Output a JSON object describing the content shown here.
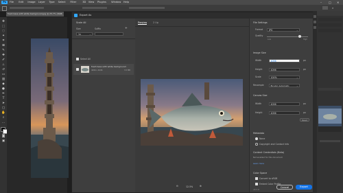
{
  "app": {
    "logo": "Ps"
  },
  "menu": [
    "File",
    "Edit",
    "Image",
    "Layer",
    "Type",
    "Select",
    "Filter",
    "3D",
    "View",
    "Plugins",
    "Window",
    "Help"
  ],
  "doc_tab": {
    "title": "fresh bass with white background.jpg @ 25.7% (RGB/8)"
  },
  "dialog": {
    "title": "Export As",
    "scale_all": {
      "header": "Scale All",
      "size_label": "Size",
      "suffix_label": "Suffix",
      "size_value": "1x",
      "suffix_value": "",
      "add_symbol": "+"
    },
    "select_all_label": "Select All",
    "layer_item": {
      "name": "fresh bass with white background",
      "size": "4096 x 4096",
      "filesize": "3.5 MB"
    },
    "preview_tabs": [
      "Preview",
      "2 Up"
    ],
    "zoom": "12.5%",
    "file_settings": {
      "header": "File Settings",
      "format_label": "Format",
      "format_value": "JPG",
      "quality_label": "Quality",
      "quality_low": "Low",
      "quality_high": "High",
      "quality": 0.8
    },
    "image_size": {
      "header": "Image Size",
      "width_label": "Width",
      "width_value": "4096",
      "height_label": "Height",
      "height_value": "4096",
      "scale_label": "Scale",
      "scale_value": "100%",
      "resample_label": "Resample",
      "resample_value": "Bicubic Automatic",
      "unit": "px"
    },
    "canvas_size": {
      "header": "Canvas Size",
      "width_label": "Width",
      "width_value": "4096",
      "height_label": "Height",
      "height_value": "4096",
      "unit": "px",
      "reset_label": "Reset"
    },
    "metadata": {
      "header": "Metadata",
      "option_none": "None",
      "option_copyright": "Copyright and Contact Info"
    },
    "content_credentials": {
      "header": "Content Credentials (Beta)",
      "status": "Not enabled for this document",
      "learn": "Learn more"
    },
    "color_space": {
      "header": "Color Space",
      "convert_label": "Convert to sRGB",
      "embed_label": "Embed Color Profile"
    },
    "version": "v8.5.8",
    "cancel_label": "Cancel",
    "export_label": "Export"
  },
  "colors": {
    "accent": "#1473e6",
    "dialog_bg": "#3a3a3a",
    "menubar": "#4a4a4a"
  }
}
